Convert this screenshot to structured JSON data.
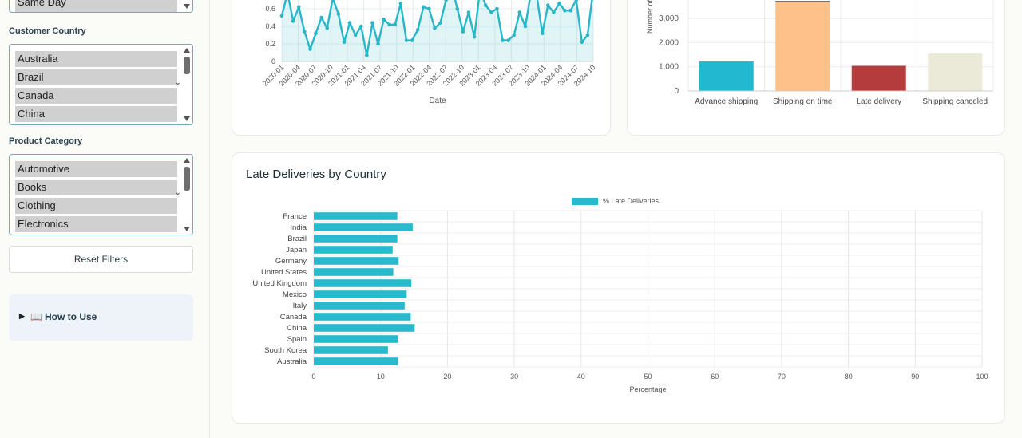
{
  "sidebar": {
    "shipping_mode_selected": "Same Day",
    "country_label": "Customer Country",
    "countries": [
      "Australia",
      "Brazil",
      "Canada",
      "China"
    ],
    "category_label": "Product Category",
    "categories": [
      "Automotive",
      "Books",
      "Clothing",
      "Electronics"
    ],
    "reset_label": "Reset Filters",
    "howto_icon": "📖",
    "howto_label": "How to Use"
  },
  "line_chart": {
    "xlabel": "Date",
    "y_ticks": [
      "0",
      "0.2",
      "0.4",
      "0.6"
    ],
    "x_ticks": [
      "2020-01",
      "2020-04",
      "2020-07",
      "2020-10",
      "2021-01",
      "2021-04",
      "2021-07",
      "2021-10",
      "2022-01",
      "2022-04",
      "2022-07",
      "2022-10",
      "2023-01",
      "2023-04",
      "2023-07",
      "2023-10",
      "2024-01",
      "2024-04",
      "2024-07",
      "2024-10"
    ],
    "values": [
      0.52,
      0.78,
      0.46,
      0.62,
      0.34,
      0.14,
      0.32,
      0.5,
      0.38,
      0.72,
      0.54,
      0.22,
      0.44,
      0.3,
      0.4,
      0.07,
      0.44,
      0.2,
      0.48,
      0.42,
      0.42,
      0.66,
      0.24,
      0.24,
      0.36,
      0.62,
      0.6,
      0.38,
      0.44,
      0.7,
      0.86,
      0.6,
      0.34,
      0.56,
      0.28,
      0.82,
      0.64,
      0.56,
      0.6,
      0.24,
      0.24,
      0.3,
      0.56,
      0.4,
      0.78,
      0.76,
      0.32,
      0.64,
      0.56,
      0.66,
      0.58,
      0.58,
      0.7,
      0.22,
      0.3,
      0.82
    ],
    "color": "#29b6c8"
  },
  "bar_chart": {
    "ylabel": "Number of",
    "y_ticks": [
      "0",
      "1,000",
      "2,000",
      "3,000"
    ],
    "categories": [
      "Advance shipping",
      "Shipping on time",
      "Late delivery",
      "Shipping canceled"
    ],
    "values": [
      1220,
      3700,
      1040,
      1550
    ],
    "colors": [
      "#22b8cf",
      "#ffc18a",
      "#b53c3c",
      "#ebe9d8"
    ]
  },
  "late_chart": {
    "title": "Late Deliveries by Country",
    "legend": "% Late Deliveries",
    "xlabel": "Percentage",
    "color": "#29b9cc",
    "x_ticks": [
      "0",
      "10",
      "20",
      "30",
      "40",
      "50",
      "60",
      "70",
      "80",
      "90",
      "100"
    ],
    "xlim": [
      0,
      100
    ],
    "countries": [
      "France",
      "India",
      "Brazil",
      "Japan",
      "Germany",
      "United States",
      "United Kingdom",
      "Mexico",
      "Italy",
      "Canada",
      "China",
      "Spain",
      "South Korea",
      "Australia"
    ],
    "values": [
      12.5,
      14.8,
      12.5,
      11.8,
      12.7,
      11.9,
      14.6,
      13.9,
      13.6,
      14.5,
      15.1,
      12.6,
      11.1,
      12.6
    ]
  },
  "chart_data": [
    {
      "type": "line",
      "xlabel": "Date",
      "ylabel": "",
      "ylim": [
        0,
        0.8
      ],
      "x_ticks": [
        "2020-01",
        "2020-04",
        "2020-07",
        "2020-10",
        "2021-01",
        "2021-04",
        "2021-07",
        "2021-10",
        "2022-01",
        "2022-04",
        "2022-07",
        "2022-10",
        "2023-01",
        "2023-04",
        "2023-07",
        "2023-10",
        "2024-01",
        "2024-04",
        "2024-07",
        "2024-10"
      ]
    },
    {
      "type": "bar",
      "categories": [
        "Advance shipping",
        "Shipping on time",
        "Late delivery",
        "Shipping canceled"
      ],
      "values": [
        1220,
        3700,
        1040,
        1550
      ],
      "ylabel": "Number of"
    },
    {
      "type": "bar",
      "orientation": "horizontal",
      "title": "Late Deliveries by Country",
      "series": [
        {
          "name": "% Late Deliveries",
          "values": [
            12.5,
            14.8,
            12.5,
            11.8,
            12.7,
            11.9,
            14.6,
            13.9,
            13.6,
            14.5,
            15.1,
            12.6,
            11.1,
            12.6
          ]
        }
      ],
      "categories": [
        "France",
        "India",
        "Brazil",
        "Japan",
        "Germany",
        "United States",
        "United Kingdom",
        "Mexico",
        "Italy",
        "Canada",
        "China",
        "Spain",
        "South Korea",
        "Australia"
      ],
      "xlabel": "Percentage",
      "xlim": [
        0,
        100
      ]
    }
  ]
}
